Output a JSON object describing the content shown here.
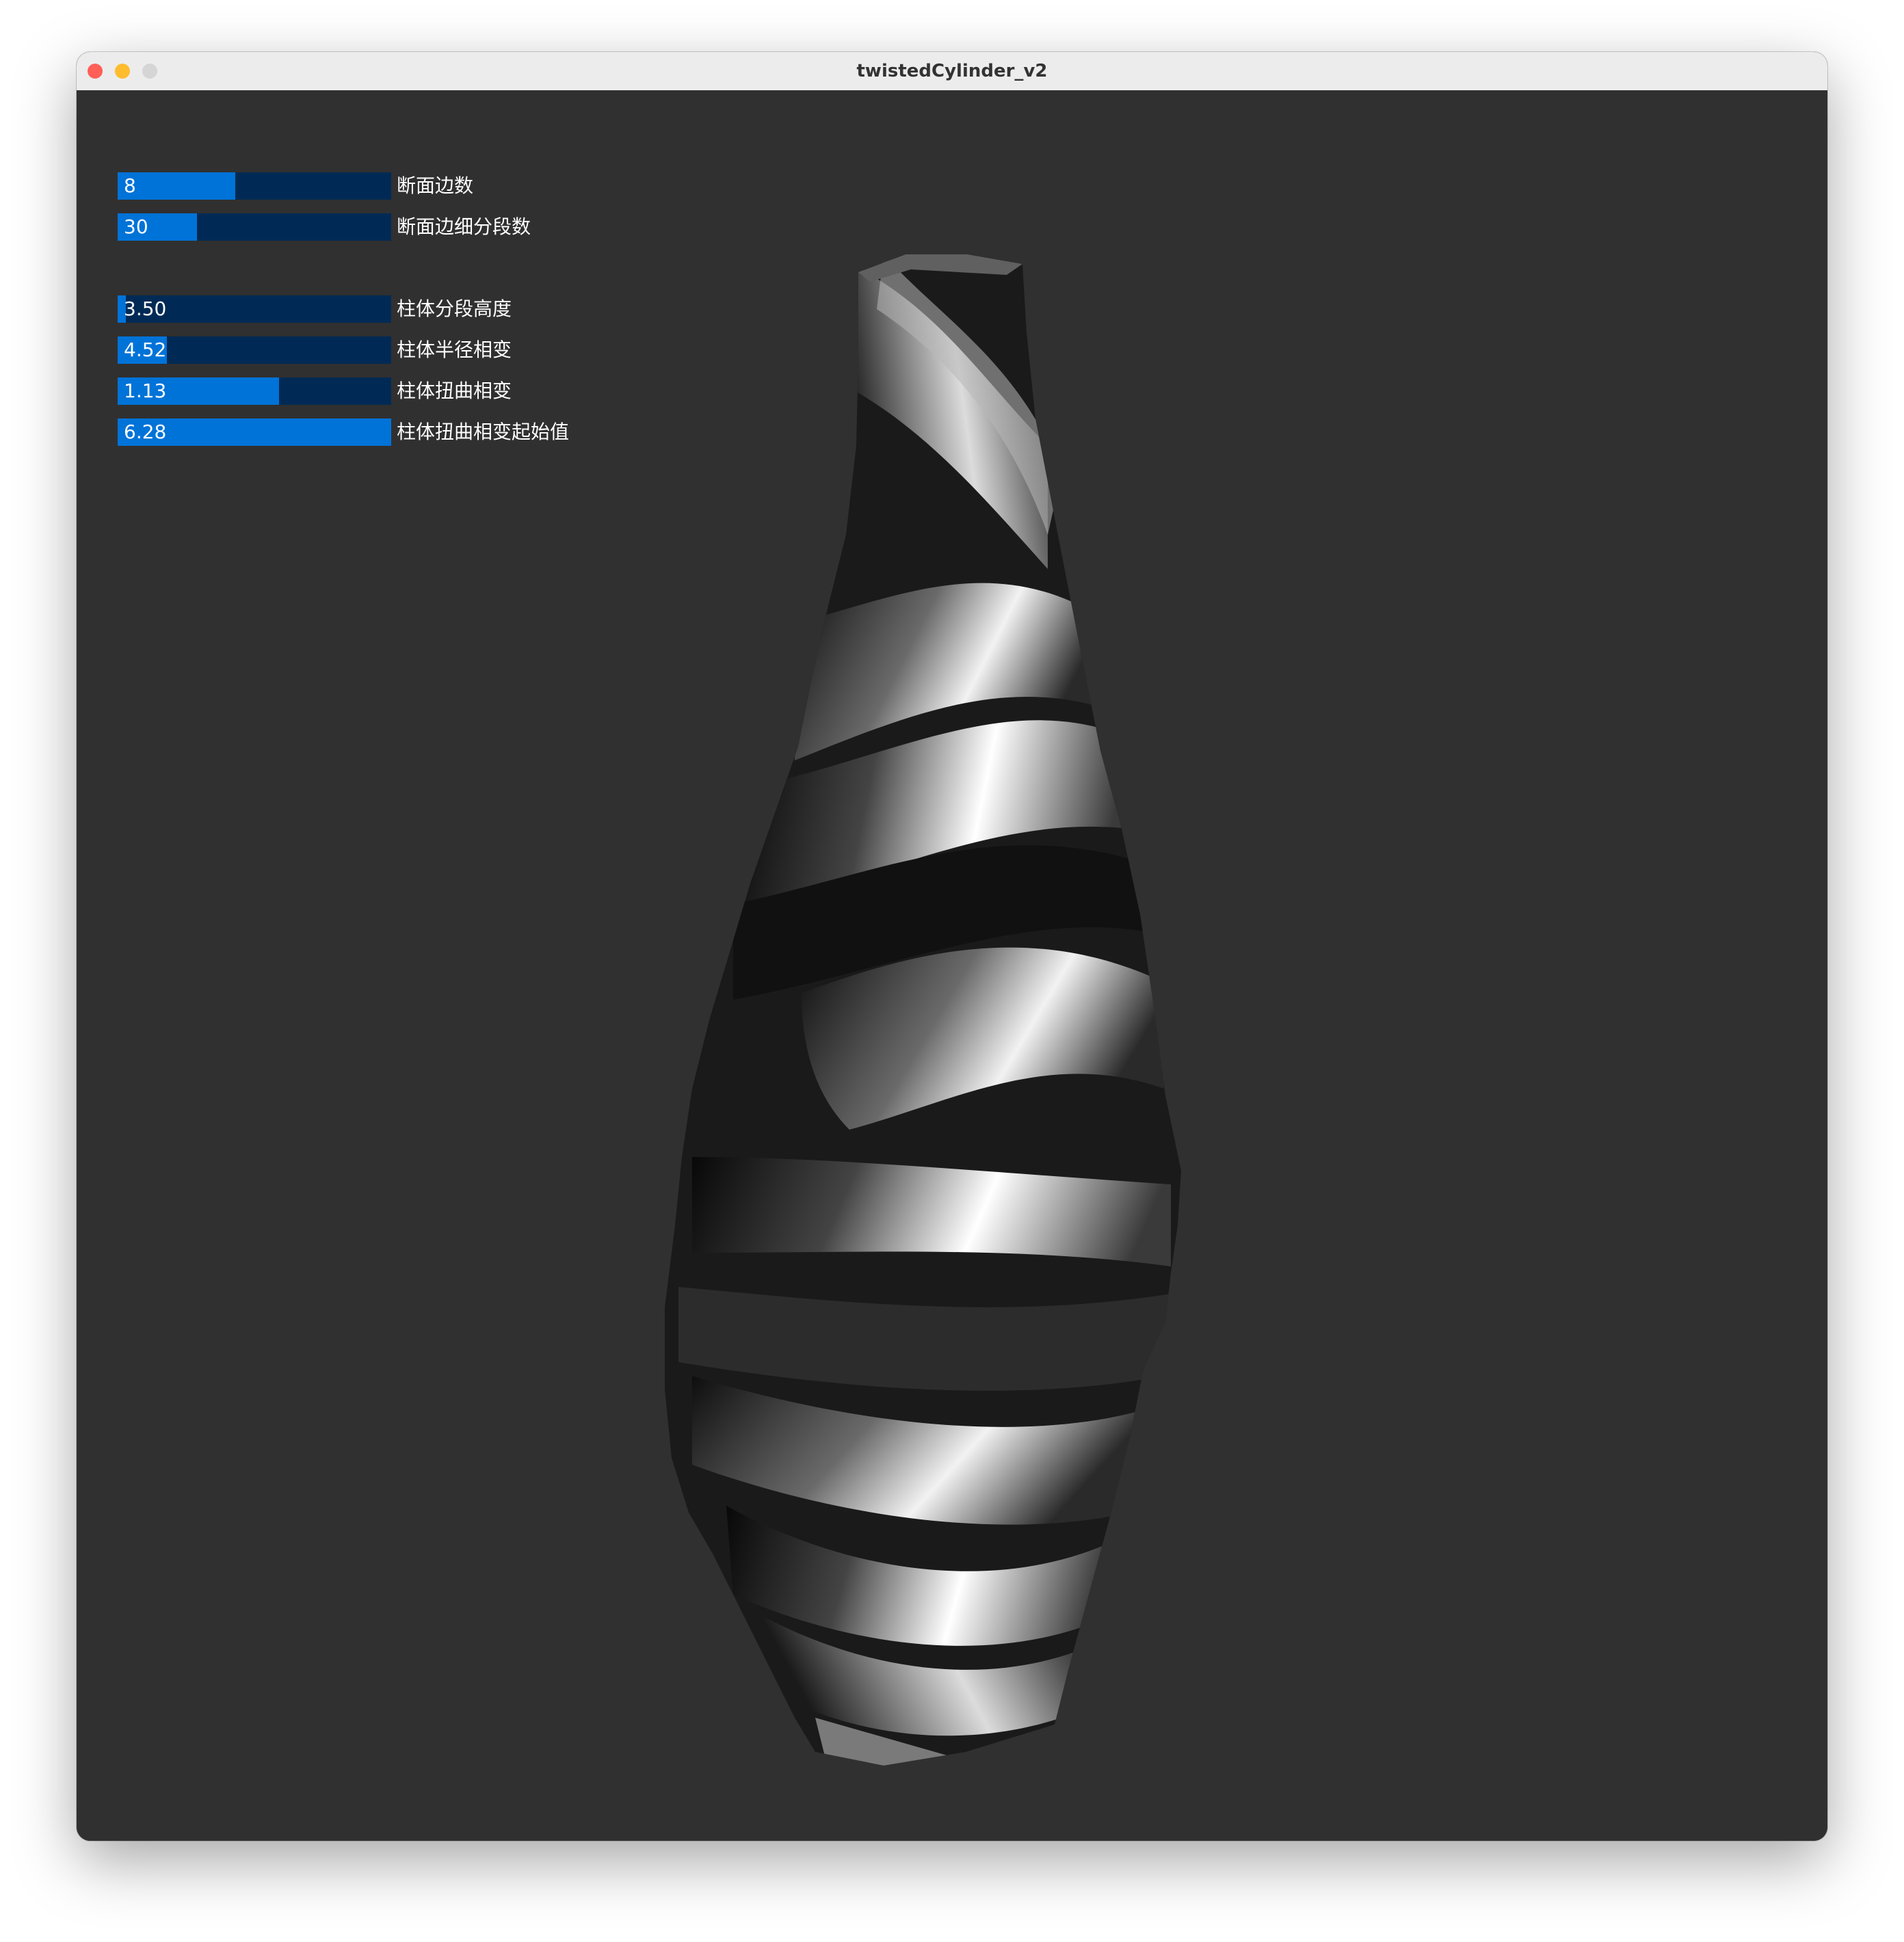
{
  "window": {
    "title": "twistedCylinder_v2",
    "controls": [
      "close",
      "minimize",
      "zoom"
    ],
    "colors": {
      "close": "#ff5f57",
      "minimize": "#febc2e",
      "zoom": "#d5d5d5",
      "canvas_background": "#303030"
    }
  },
  "controls": [
    {
      "value": "8",
      "label": "断面边数",
      "fill_fraction": 0.43
    },
    {
      "value": "30",
      "label": "断面边细分段数",
      "fill_fraction": 0.29
    },
    {
      "value": "3.50",
      "label": "柱体分段高度",
      "fill_fraction": 0.03
    },
    {
      "value": "4.52",
      "label": "柱体半径相变",
      "fill_fraction": 0.18
    },
    {
      "value": "1.13",
      "label": "柱体扭曲相变",
      "fill_fraction": 0.59
    },
    {
      "value": "6.28",
      "label": "柱体扭曲相变起始值",
      "fill_fraction": 1.0
    }
  ],
  "slider_colors": {
    "track": "#002a55",
    "fill": "#0073d8",
    "text": "#ffffff"
  },
  "viewport": {
    "object": "twisted-cylinder-mesh",
    "shading": "grayscale"
  }
}
